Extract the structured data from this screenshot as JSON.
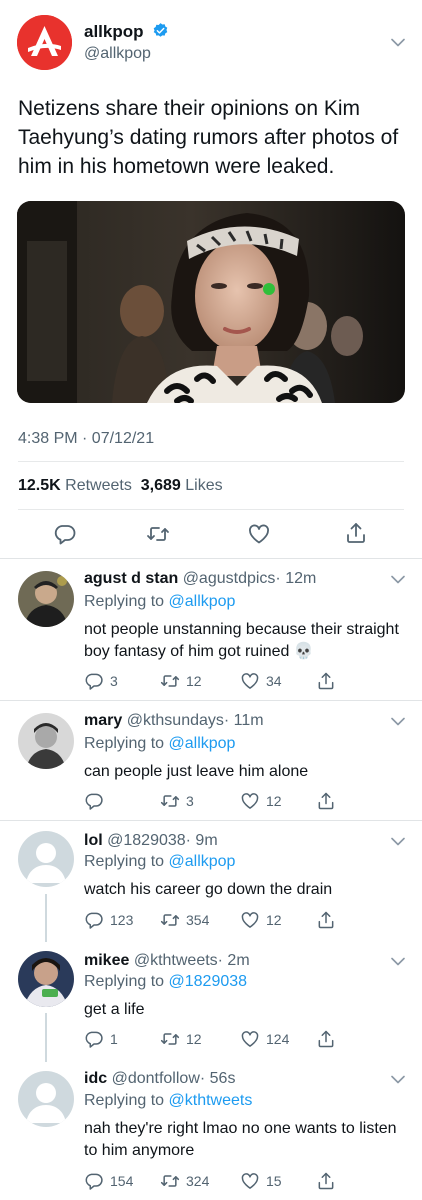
{
  "tweet": {
    "author_name": "allkpop",
    "author_handle": "@allkpop",
    "text": "Netizens share their opinions on Kim Taehyung’s dating rumors after photos of him in his hometown were leaked.",
    "timestamp": "4:38 PM · 07/12/21",
    "retweets_count": "12.5K",
    "retweets_label": "Retweets",
    "likes_count": "3,689",
    "likes_label": "Likes"
  },
  "replies": [
    {
      "name": "agust d stan",
      "handle": "@agustdpics",
      "time": "· 12m",
      "replying_label": "Replying to",
      "replying_to": "@allkpop",
      "text": "not people unstanning because their straight boy fantasy of him got ruined 💀",
      "replies": "3",
      "retweets": "12",
      "likes": "34"
    },
    {
      "name": "mary",
      "handle": "@kthsundays",
      "time": "· 11m",
      "replying_label": "Replying to",
      "replying_to": "@allkpop",
      "text": "can people just leave him alone",
      "replies": "",
      "retweets": "3",
      "likes": "12"
    },
    {
      "name": "lol",
      "handle": "@1829038",
      "time": "· 9m",
      "replying_label": "Replying to",
      "replying_to": "@allkpop",
      "text": "watch his career go down the drain",
      "replies": "123",
      "retweets": "354",
      "likes": "12"
    },
    {
      "name": "mikee",
      "handle": "@kthtweets",
      "time": "· 2m",
      "replying_label": "Replying to",
      "replying_to": "@1829038",
      "text": "get a life",
      "replies": "1",
      "retweets": "12",
      "likes": "124"
    },
    {
      "name": "idc",
      "handle": "@dontfollow",
      "time": "· 56s",
      "replying_label": "Replying to",
      "replying_to": "@kthtweets",
      "text": "nah they're right lmao no one wants to listen to him anymore",
      "replies": "154",
      "retweets": "324",
      "likes": "15"
    }
  ],
  "icons": {
    "reply": "reply-icon",
    "retweet": "retweet-icon",
    "like": "heart-icon",
    "share": "share-icon",
    "verified": "verified-badge-icon",
    "more": "chevron-down-icon"
  },
  "colors": {
    "brand_red": "#e8322d",
    "link_blue": "#1d9bf0",
    "muted": "#536471",
    "text": "#0f1419"
  }
}
